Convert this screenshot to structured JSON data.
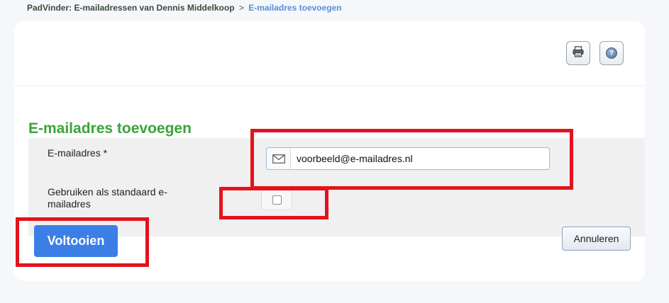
{
  "breadcrumb": {
    "app": "PadVinder:",
    "parent": "E-mailadressen van Dennis Middelkoop",
    "separator": ">",
    "current": "E-mailadres toevoegen"
  },
  "toolbar": {
    "print_icon": "printer-icon",
    "help_icon": "help-icon",
    "help_glyph": "?"
  },
  "form": {
    "title": "E-mailadres toevoegen",
    "email_label": "E-mailadres *",
    "email_value": "voorbeeld@e-mailadres.nl",
    "email_icon": "envelope-icon",
    "default_label": "Gebruiken als standaard e-mailadres",
    "default_checked": false
  },
  "actions": {
    "submit_label": "Voltooien",
    "cancel_label": "Annuleren"
  },
  "colors": {
    "title_green": "#3aa43a",
    "primary_blue": "#3b7fe6",
    "highlight_red": "#e3121c",
    "breadcrumb_link": "#5b8fd6"
  }
}
